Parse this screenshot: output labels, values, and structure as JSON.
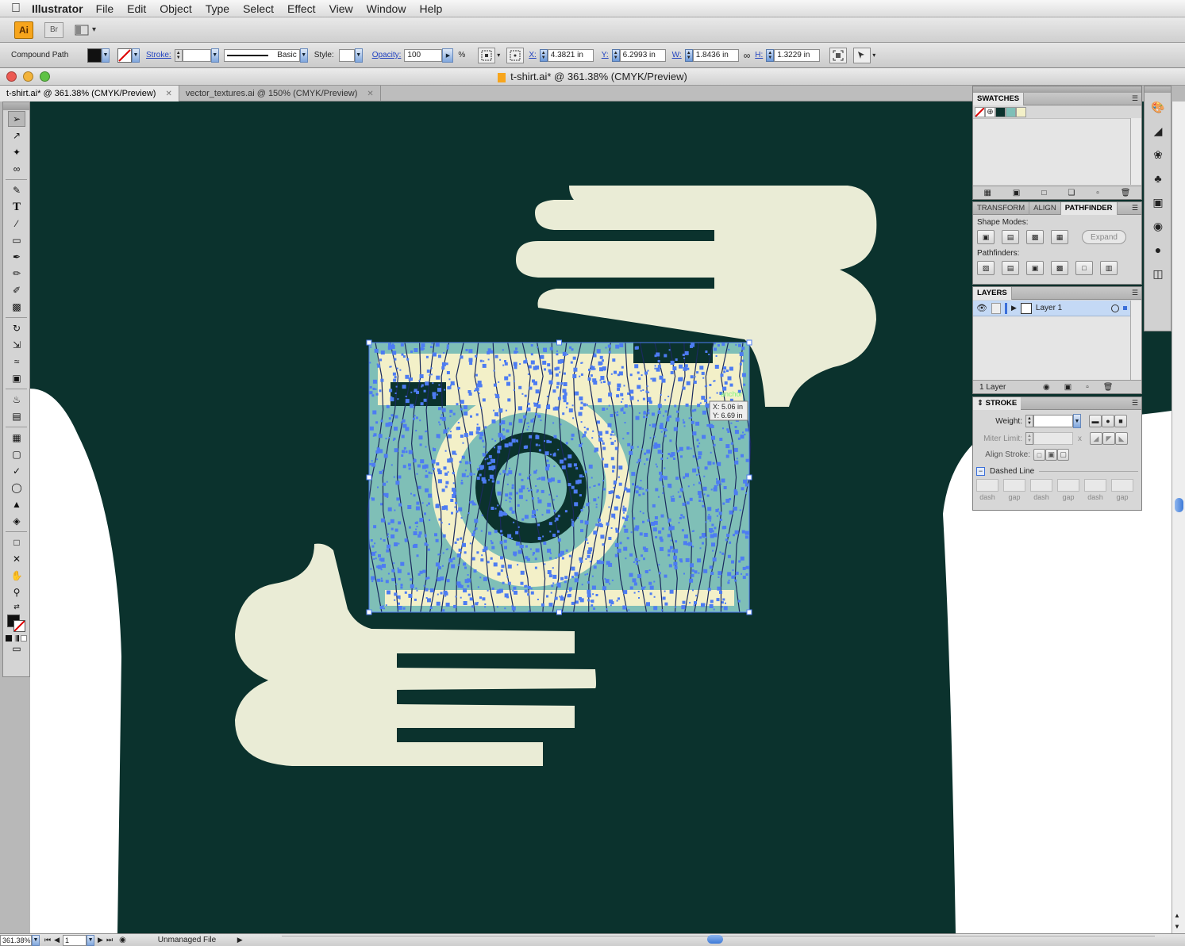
{
  "menubar": {
    "app_name": "Illustrator",
    "items": [
      "File",
      "Edit",
      "Object",
      "Type",
      "Select",
      "Effect",
      "View",
      "Window",
      "Help"
    ]
  },
  "appbar": {
    "ai_label": "Ai",
    "br_label": "Br"
  },
  "control": {
    "selection_type": "Compound Path",
    "stroke_label": "Stroke:",
    "brush_label": "Basic",
    "style_label": "Style:",
    "opacity_label": "Opacity:",
    "opacity_value": "100",
    "percent": "%",
    "x_label": "X:",
    "x_value": "4.3821 in",
    "y_label": "Y:",
    "y_value": "6.2993 in",
    "w_label": "W:",
    "w_value": "1.8436 in",
    "h_label": "H:",
    "h_value": "1.3229 in"
  },
  "window": {
    "title": "t-shirt.ai* @ 361.38% (CMYK/Preview)",
    "tabs": [
      {
        "label": "t-shirt.ai* @ 361.38% (CMYK/Preview)",
        "active": true
      },
      {
        "label": "vector_textures.ai @ 150% (CMYK/Preview)",
        "active": false
      }
    ]
  },
  "canvas": {
    "tooltip_x": "X: 5.06 in",
    "tooltip_y": "Y: 6.69 in",
    "hint": "anchor",
    "colors": {
      "background": "#0b322d",
      "shirt": "#ffffff",
      "hands": "#eaecd6",
      "selection": "#4d7cf2",
      "teal": "#7fbfb7"
    }
  },
  "swatches": {
    "tab": "SWATCHES",
    "colors": [
      "#0b322d",
      "#7fbfb7",
      "#f3f0c8"
    ]
  },
  "pathfinder": {
    "tabs": [
      "TRANSFORM",
      "ALIGN",
      "PATHFINDER"
    ],
    "shape_modes_label": "Shape Modes:",
    "expand_label": "Expand",
    "pathfinders_label": "Pathfinders:"
  },
  "layers": {
    "tab": "LAYERS",
    "layer_name": "Layer 1",
    "count": "1 Layer"
  },
  "stroke": {
    "tab": "STROKE",
    "weight_label": "Weight:",
    "miter_label": "Miter Limit:",
    "miter_x": "x",
    "align_label": "Align Stroke:",
    "dashed_label": "Dashed Line",
    "dash_labels": [
      "dash",
      "gap",
      "dash",
      "gap",
      "dash",
      "gap"
    ]
  },
  "status": {
    "zoom": "361.38%",
    "page": "1",
    "file_status": "Unmanaged File"
  }
}
